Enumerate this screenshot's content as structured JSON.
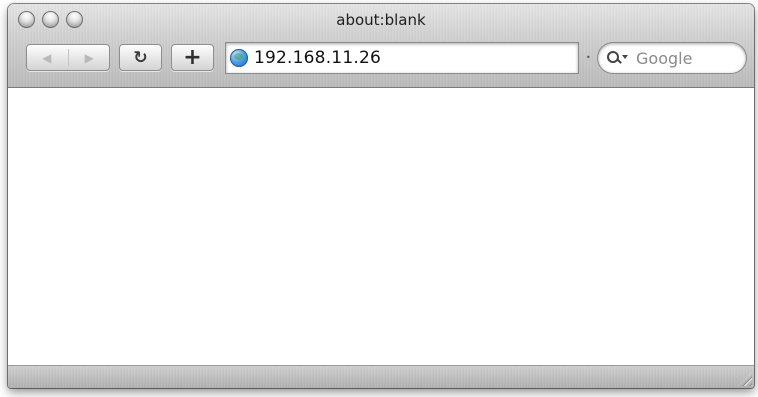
{
  "window": {
    "title": "about:blank"
  },
  "toolbar": {
    "back_glyph": "◀",
    "forward_glyph": "▶",
    "reload_glyph": "↻",
    "add_bookmark_glyph": "+",
    "address": "192.168.11.26",
    "search_placeholder": "Google",
    "icons": {
      "back": "back-arrow-icon",
      "forward": "forward-arrow-icon",
      "reload": "reload-icon",
      "add": "add-bookmark-icon",
      "site": "globe-icon",
      "search": "search-icon"
    }
  },
  "colors": {
    "chrome_top": "#e4e4e4",
    "chrome_bottom": "#bababa",
    "content_bg": "#ffffff",
    "globe": "#4aa0e8"
  }
}
